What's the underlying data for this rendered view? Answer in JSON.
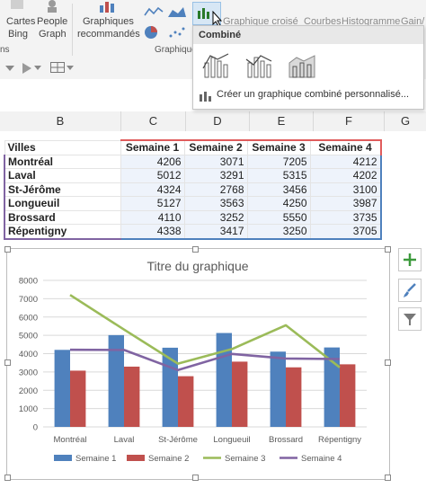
{
  "ribbon": {
    "btn_cartes_bing": [
      "Cartes",
      "Bing"
    ],
    "btn_people_graph": [
      "People",
      "Graph"
    ],
    "btn_graphiques_recommandes": [
      "Graphiques",
      "recommandés"
    ],
    "graph_group_title": "Graphique",
    "clipped_labels": [
      "Graphique croisé",
      "Courbes",
      "Histogramme",
      "Gain/"
    ],
    "left_fragment": "ns"
  },
  "dropdown": {
    "header": "Combiné",
    "custom_link": "Créer un graphique combiné personnalisé..."
  },
  "columns": [
    "B",
    "C",
    "D",
    "E",
    "F",
    "G"
  ],
  "table": {
    "header": [
      "Villes",
      "Semaine 1",
      "Semaine 2",
      "Semaine 3",
      "Semaine 4"
    ],
    "rows": [
      [
        "Montréal",
        "4206",
        "3071",
        "7205",
        "4212"
      ],
      [
        "Laval",
        "5012",
        "3291",
        "5315",
        "4202"
      ],
      [
        "St-Jérôme",
        "4324",
        "2768",
        "3456",
        "3100"
      ],
      [
        "Longueuil",
        "5127",
        "3563",
        "4250",
        "3987"
      ],
      [
        "Brossard",
        "4110",
        "3252",
        "5550",
        "3735"
      ],
      [
        "Répentigny",
        "4338",
        "3417",
        "3250",
        "3705"
      ]
    ]
  },
  "chart_data": {
    "type": "bar",
    "title": "Titre du graphique",
    "categories": [
      "Montréal",
      "Laval",
      "St-Jérôme",
      "Longueuil",
      "Brossard",
      "Répentigny"
    ],
    "series": [
      {
        "name": "Semaine 1",
        "type": "bar",
        "color": "#4f81bd",
        "values": [
          4206,
          5012,
          4324,
          5127,
          4110,
          4338
        ]
      },
      {
        "name": "Semaine 2",
        "type": "bar",
        "color": "#c0504d",
        "values": [
          3071,
          3291,
          2768,
          3563,
          3252,
          3417
        ]
      },
      {
        "name": "Semaine 3",
        "type": "line",
        "color": "#9bbb59",
        "values": [
          7205,
          5315,
          3456,
          4250,
          5550,
          3250
        ]
      },
      {
        "name": "Semaine 4",
        "type": "line",
        "color": "#8064a2",
        "values": [
          4212,
          4202,
          3100,
          3987,
          3735,
          3705
        ]
      }
    ],
    "ylim": [
      0,
      8000
    ],
    "yticks": [
      "0",
      "1000",
      "2000",
      "3000",
      "4000",
      "5000",
      "6000",
      "7000",
      "8000"
    ],
    "grid": true,
    "legend": "bottom"
  },
  "side_buttons": [
    "plus-icon",
    "brush-icon",
    "filter-icon"
  ]
}
